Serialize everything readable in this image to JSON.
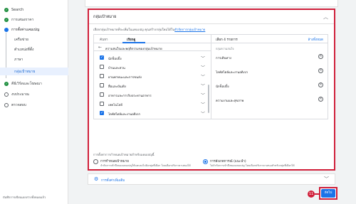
{
  "sidebar": {
    "items": [
      {
        "label": "Search",
        "state": "done"
      },
      {
        "label": "การเสนอราคา",
        "state": "done"
      },
      {
        "label": "การตั้งค่าแคมเปญ",
        "state": "active-parent"
      },
      {
        "label": "เครือข่าย",
        "state": "sub"
      },
      {
        "label": "ตำแหน่งที่ตั้ง",
        "state": "sub"
      },
      {
        "label": "ภาษา",
        "state": "sub"
      },
      {
        "label": "กลุ่มเป้าหมาย",
        "state": "sub-active"
      },
      {
        "label": "คีย์เวิร์ดและโฆษณา",
        "state": "done"
      },
      {
        "label": "งบประมาณ",
        "state": "todo"
      },
      {
        "label": "ตรวจสอบ",
        "state": "todo"
      }
    ],
    "footer": "บันทึกการเขียนแบบร่างทั้งหมดแล้ว"
  },
  "card": {
    "title": "กลุ่มเป้าหมาย",
    "description": "เลือกกลุ่มเป้าหมายที่จะเพิ่มในแคมเปญ คุณสร้างกลุ่มใหม่ได้ใน",
    "description_link": "ตัวจัดการกลุ่มเป้าหมาย"
  },
  "picker": {
    "tabs": [
      "ค้นหา",
      "เรียกดู"
    ],
    "back_label": "ความสนใจและพฤติกรรมของกลุ่มเป้าหมาย",
    "items": [
      {
        "label": "นักช็อปปิ้ง",
        "checked": true
      },
      {
        "label": "บ้านและสวน",
        "checked": false
      },
      {
        "label": "ยานพาหนะและการขนส่ง",
        "checked": false
      },
      {
        "label": "สื่อและบันเทิง",
        "checked": false
      },
      {
        "label": "อาหารและการรับประทานอาหาร",
        "checked": false
      },
      {
        "label": "เทคโนโลยี",
        "checked": false
      },
      {
        "label": "ไลฟ์สไตล์และงานอดิเรก",
        "checked": true
      }
    ],
    "selected_count": "เลือก 4 รายการ",
    "clear_all": "ล้างทั้งหมด",
    "selected_sub": "กลุ่มความสนใจ",
    "selected": [
      "การเดินทาง",
      "ไลฟ์สไตล์และงานอดิเรก",
      "นักช็อปปิ้ง",
      "ความงามและสุขภาพ"
    ]
  },
  "targeting": {
    "question": "การตั้งค่าการกำหนดเป้าหมายสำหรับแคมเปญนี้",
    "options": [
      {
        "title": "การกำหนดเป้าหมาย",
        "desc": "จำกัดการเข้าถึงของแคมเปญให้แคบลงไปยังกลุ่มที่เลือก โดยเลือกปรับราคาเสนอได้",
        "selected": false
      },
      {
        "title": "การสังเกตการณ์ (แนะนำ)",
        "desc": "ไม่จำกัดการเข้าถึงของแคมเปญ โดยเลือกปรับราคาเสนอสำหรับกลุ่มที่เลือกได้",
        "selected": true
      }
    ]
  },
  "more_settings": "การตั้งค่าเพิ่มเติม",
  "next_button": "ถัดไป",
  "step_badge": "11",
  "colors": {
    "accent": "#1a73e8",
    "highlight": "#d01f3a",
    "success": "#1e8e3e"
  }
}
